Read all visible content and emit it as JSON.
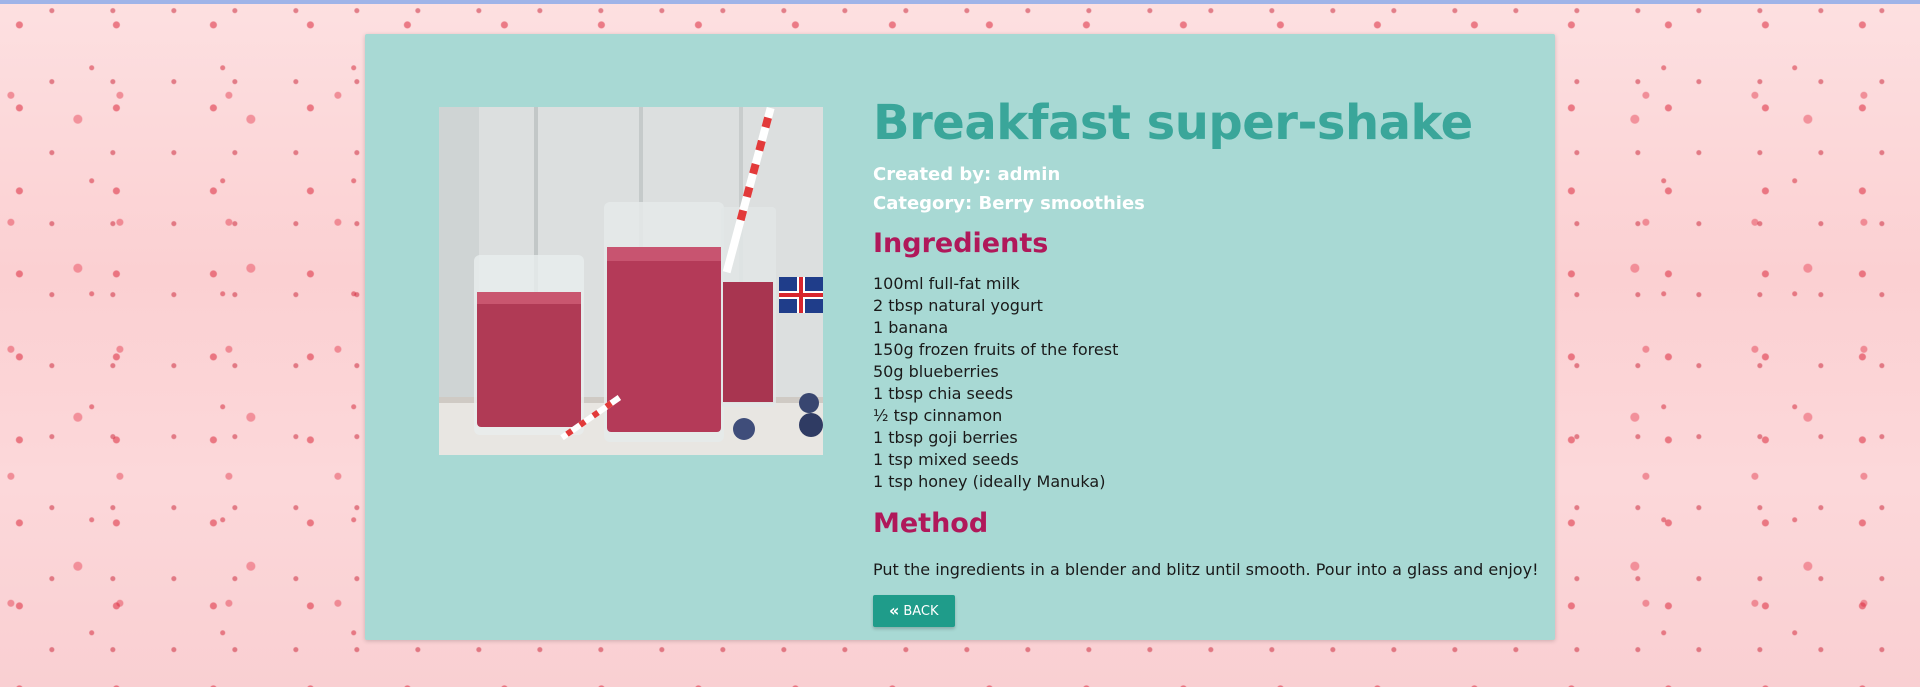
{
  "recipe": {
    "title": "Breakfast super-shake",
    "created_by": "Created by: admin",
    "category": "Category: Berry smoothies",
    "ingredients_heading": "Ingredients",
    "ingredients": [
      "100ml full-fat milk",
      "2 tbsp natural yogurt",
      "1 banana",
      "150g frozen fruits of the forest",
      "50g blueberries",
      "1 tbsp chia seeds",
      "½ tsp cinnamon",
      "1 tbsp goji berries",
      "1 tsp mixed seeds",
      "1 tsp honey (ideally Manuka)"
    ],
    "method_heading": "Method",
    "method": "Put the ingredients in a blender and blitz until smooth. Pour into a glass and enjoy!"
  },
  "actions": {
    "back_label": "BACK",
    "back_icon": "double-chevron-left-icon"
  },
  "colors": {
    "card_background": "#a8d9d4",
    "title": "#3aa69a",
    "section_heading": "#b0185a",
    "button": "#1f9c8a",
    "page_background": "#fbd2d4"
  }
}
